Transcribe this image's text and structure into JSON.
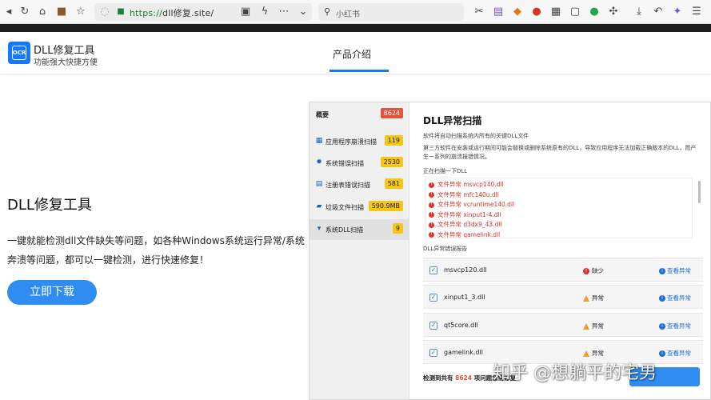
{
  "browser": {
    "url_scheme": "https://",
    "url_host": "dll修复.site/",
    "search_placeholder": "小红书"
  },
  "site": {
    "brand_logo": "OCR",
    "brand_title": "DLL修复工具",
    "brand_subtitle": "功能强大快捷方便",
    "nav_tab": "产品介绍",
    "accent_color": "#1677ff"
  },
  "hero": {
    "title": "DLL修复工具",
    "description": "一键就能检测dll文件缺失等问题，如各种Windows系统运行异常/系统奔溃等问题，都可以一键检测，进行快速修复！",
    "download_label": "立即下载"
  },
  "app": {
    "sidebar": [
      {
        "label": "概要",
        "badge": "8624",
        "icon": "none"
      },
      {
        "label": "应用程序崩溃扫描",
        "badge": "119",
        "icon": "app-grid-icon"
      },
      {
        "label": "系统错误扫描",
        "badge": "2530",
        "icon": "gear-icon"
      },
      {
        "label": "注册表错误扫描",
        "badge": "581",
        "icon": "registry-icon"
      },
      {
        "label": "垃圾文件扫描",
        "badge": "590.9MB",
        "icon": "folder-icon"
      },
      {
        "label": "系统DLL扫描",
        "badge": "9",
        "icon": "trash-icon"
      }
    ],
    "scan_title": "DLL异常扫描",
    "intro1": "软件将自动扫描系统内所有的关键DLL文件",
    "intro2": "第三方软件在安装或运行期间可能会替换或删除系统原有的DLL，导致应用程序无法加载正确版本的DLL，而产生一系列的崩溃报错情况。",
    "scanning_label": "正在扫描一下DLL",
    "errors": [
      "文件异常 msvcp140.dll",
      "文件异常 mfc140u.dll",
      "文件异常 vcruntime140.dll",
      "文件异常 xinput1-4.dll",
      "文件异常 d3dx9_43.dll",
      "文件异常 gamelink.dll"
    ],
    "report_label": "DLL异常错误报告",
    "report": [
      {
        "name": "msvcp120.dll",
        "status": "缺少",
        "type": "missing",
        "link": "查看异常"
      },
      {
        "name": "xinput1_3.dll",
        "status": "异常",
        "type": "warning",
        "link": "查看异常"
      },
      {
        "name": "qt5core.dll",
        "status": "异常",
        "type": "warning",
        "link": "查看异常"
      },
      {
        "name": "gamelink.dll",
        "status": "异常",
        "type": "warning",
        "link": "查看异常"
      }
    ],
    "summary_prefix": "检测到共有",
    "summary_count": "8624",
    "summary_suffix": "项问题急需修复"
  },
  "watermark": "知乎 @想躺平的宅男"
}
